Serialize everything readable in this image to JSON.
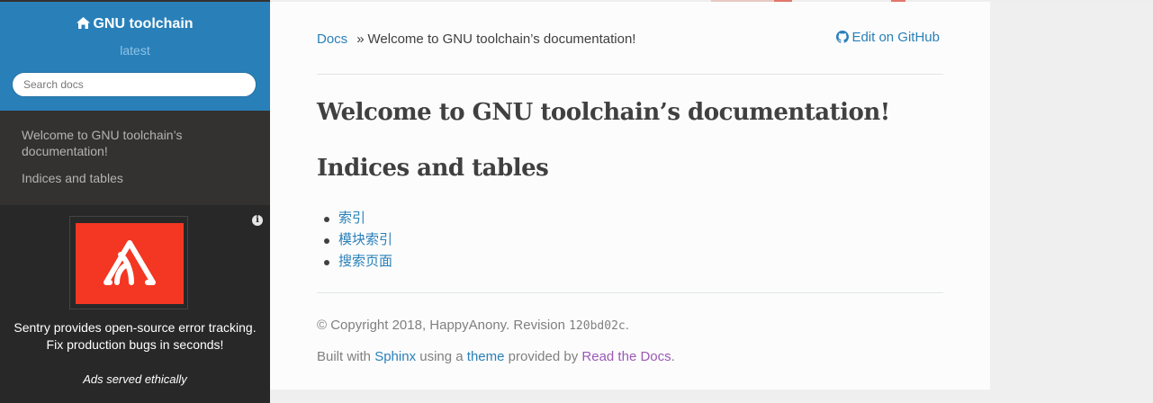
{
  "sidebar": {
    "brand": "GNU toolchain",
    "version": "latest",
    "search_placeholder": "Search docs",
    "items": [
      {
        "label": "Welcome to GNU toolchain’s documentation!"
      },
      {
        "label": "Indices and tables"
      }
    ]
  },
  "ad": {
    "text_line1": "Sentry provides open-source error tracking.",
    "text_line2": "Fix production bugs in seconds!",
    "footer": "Ads served ethically",
    "logo_color": "#f33722"
  },
  "breadcrumb": {
    "root": "Docs",
    "separator": "»",
    "current": "Welcome to GNU toolchain’s documentation!"
  },
  "edit_link": "Edit on GitHub",
  "main": {
    "title": "Welcome to GNU toolchain’s documentation!",
    "section": "Indices and tables",
    "links": [
      "索引",
      "模块索引",
      "搜索页面"
    ]
  },
  "footer": {
    "copyright": "© Copyright 2018, HappyAnony. Revision",
    "revision": "120bd02c",
    "period": ".",
    "built_prefix": "Built with",
    "sphinx": "Sphinx",
    "using": "using a",
    "theme": "theme",
    "provided": "provided by",
    "rtd": "Read the Docs",
    "end": "."
  },
  "colors": {
    "header_blue": "#2980b9",
    "sidebar_dark": "#343131",
    "link": "#2980b9",
    "rtd_purple": "#9b59b6"
  }
}
